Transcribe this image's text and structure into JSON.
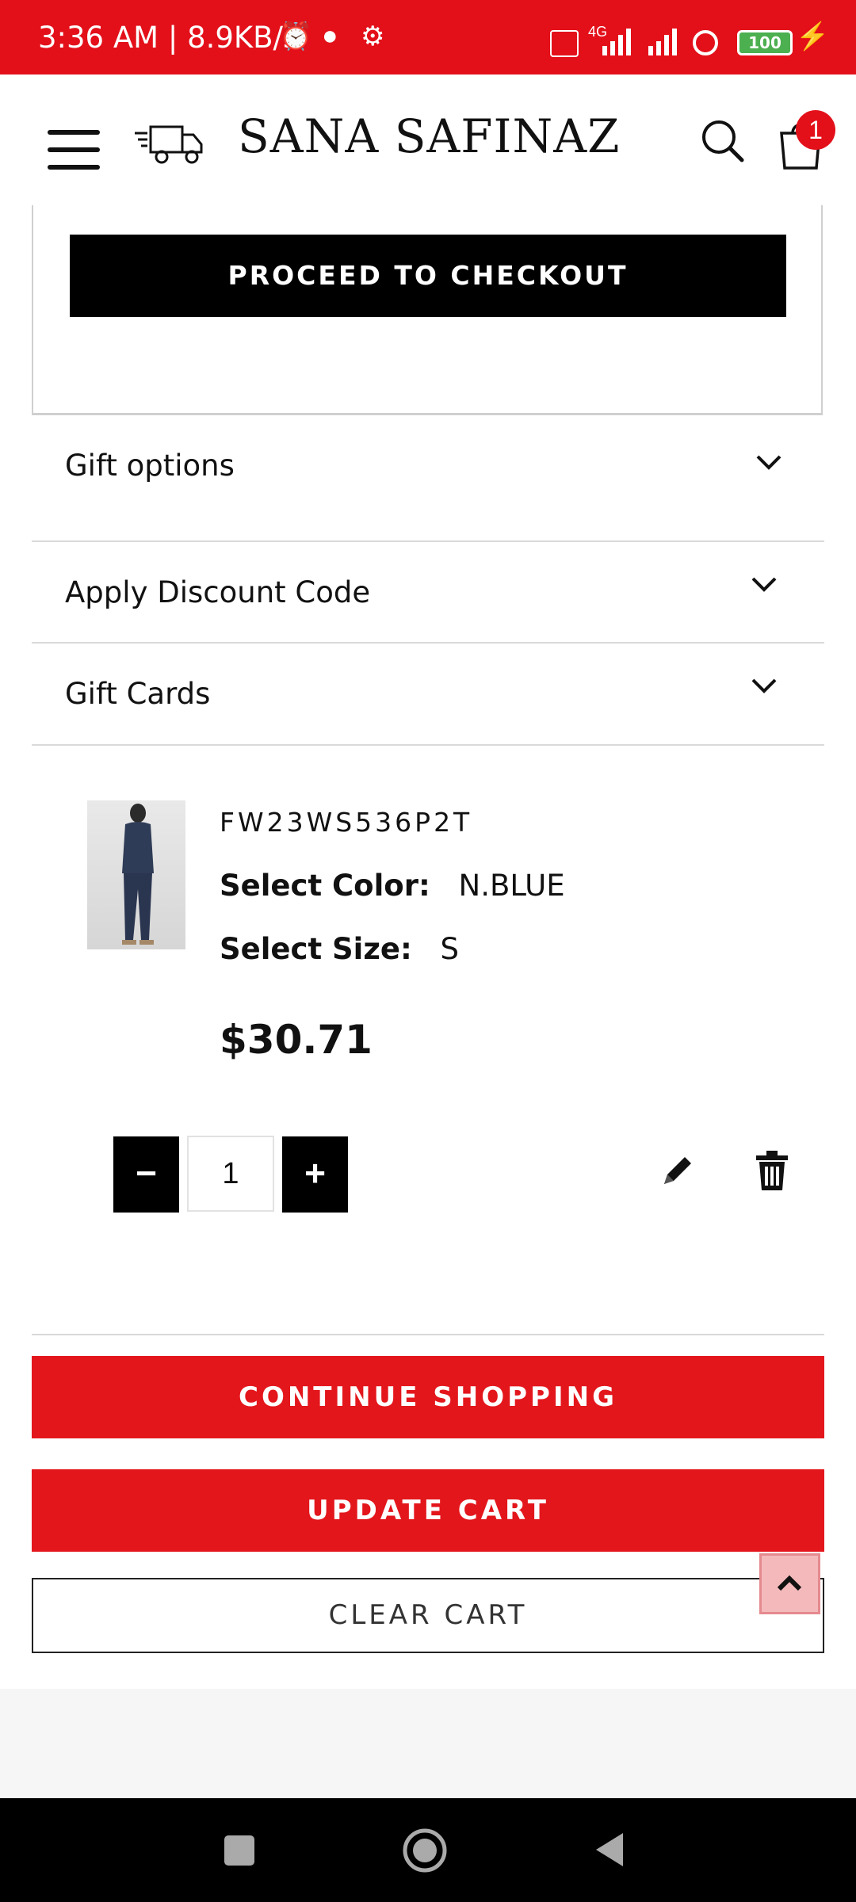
{
  "status_bar": {
    "time": "3:36 AM | 8.9KB/s",
    "network": "4G",
    "battery": "100"
  },
  "header": {
    "logo": "SANA SAFINAZ",
    "cart_count": "1"
  },
  "checkout": {
    "label": "PROCEED TO CHECKOUT"
  },
  "accordions": [
    {
      "label": "Gift options"
    },
    {
      "label": "Apply Discount Code"
    },
    {
      "label": "Gift Cards"
    }
  ],
  "cart_item": {
    "sku": "FW23WS536P2T",
    "color_label": "Select Color:",
    "color_value": "N.BLUE",
    "size_label": "Select Size:",
    "size_value": "S",
    "price": "$30.71",
    "quantity": "1"
  },
  "actions": {
    "continue_shopping": "CONTINUE SHOPPING",
    "update_cart": "UPDATE CART",
    "clear_cart": "CLEAR CART"
  },
  "colors": {
    "brand_red": "#e3101a",
    "black": "#000000"
  }
}
